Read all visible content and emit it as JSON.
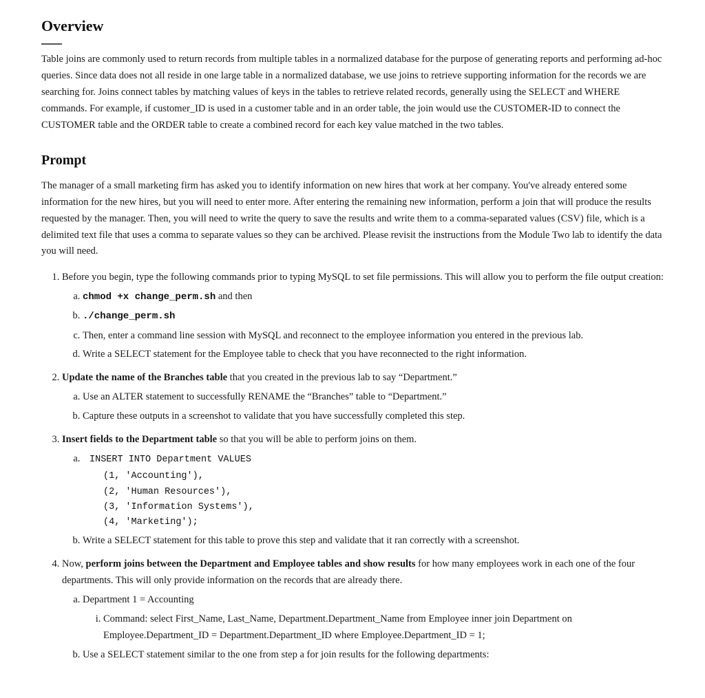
{
  "overview": {
    "title": "Overview",
    "body": "Table joins are commonly used to return records from multiple tables in a normalized database for the purpose of generating reports and performing ad-hoc queries. Since data does not all reside in one large table in a normalized database, we use joins to retrieve supporting information for the records we are searching for. Joins connect tables by matching values of keys in the tables to retrieve related records, generally using the SELECT and WHERE commands. For example, if customer_ID is used in a customer table and in an order table, the join would use the CUSTOMER-ID to connect the CUSTOMER table and the ORDER table to create a combined record for each key value matched in the two tables."
  },
  "prompt": {
    "title": "Prompt",
    "intro": "The manager of a small marketing firm has asked you to identify information on new hires that work at her company. You've already entered some information for the new hires, but you will need to enter more. After entering the remaining new information, perform a join that will produce the results requested by the manager. Then, you will need to write the query to save the results and write them to a comma-separated values (CSV) file, which is a delimited text file that uses a comma to separate values so they can be archived. Please revisit the instructions from the Module Two lab to identify the data you will need."
  },
  "steps": [
    {
      "id": "1",
      "text_before": "Before you begin, type the following commands prior to typing MySQL to set file permissions. This will allow you to perform the file output creation:",
      "sub_items": [
        {
          "id": "a",
          "parts": [
            {
              "type": "code",
              "text": "chmod +x change_perm.sh"
            },
            {
              "type": "text",
              "text": " and then"
            }
          ]
        },
        {
          "id": "b",
          "parts": [
            {
              "type": "code",
              "text": "./change_perm.sh"
            }
          ]
        },
        {
          "id": "c",
          "text": "Then, enter a command line session with MySQL and reconnect to the employee information you entered in the previous lab."
        },
        {
          "id": "d",
          "text": "Write a SELECT statement for the Employee table to check that you have reconnected to the right information."
        }
      ]
    },
    {
      "id": "2",
      "bold_start": "Update the name of the Branches table",
      "text_after": " that you created in the previous lab to say “Department.”",
      "sub_items": [
        {
          "id": "a",
          "text": "Use an ALTER statement to successfully RENAME the “Branches” table to “Department.”"
        },
        {
          "id": "b",
          "text": "Capture these outputs in a screenshot to validate that you have successfully completed this step."
        }
      ]
    },
    {
      "id": "3",
      "bold_start": "Insert fields to the Department table",
      "text_after": " so that you will be able to perform joins on them.",
      "sub_items": [
        {
          "id": "a",
          "code_lines": [
            "INSERT INTO Department VALUES",
            "(1, 'Accounting'),",
            "(2, 'Human Resources'),",
            "(3, 'Information Systems'),",
            "(4, 'Marketing');"
          ]
        },
        {
          "id": "b",
          "text": "Write a SELECT statement for this table to prove this step and validate that it ran correctly with a screenshot."
        }
      ]
    },
    {
      "id": "4",
      "text_before": "Now, ",
      "bold_middle": "perform joins between the Department and Employee tables and show results",
      "text_after": " for how many employees work in each one of the four departments. This will only provide information on the records that are already there.",
      "sub_items": [
        {
          "id": "a",
          "text": "Department 1 = Accounting",
          "roman_items": [
            {
              "id": "i",
              "text": "Command: select First_Name, Last_Name, Department.Department_Name from Employee inner join Department on Employee.Department_ID = Department.Department_ID where Employee.Department_ID = 1;"
            }
          ]
        },
        {
          "id": "b",
          "text": "Use a SELECT statement similar to the one from step a for join results for the following departments:"
        }
      ]
    }
  ],
  "labels": {
    "and_then": "and then",
    "dept_accounting": "Department Accounting"
  }
}
